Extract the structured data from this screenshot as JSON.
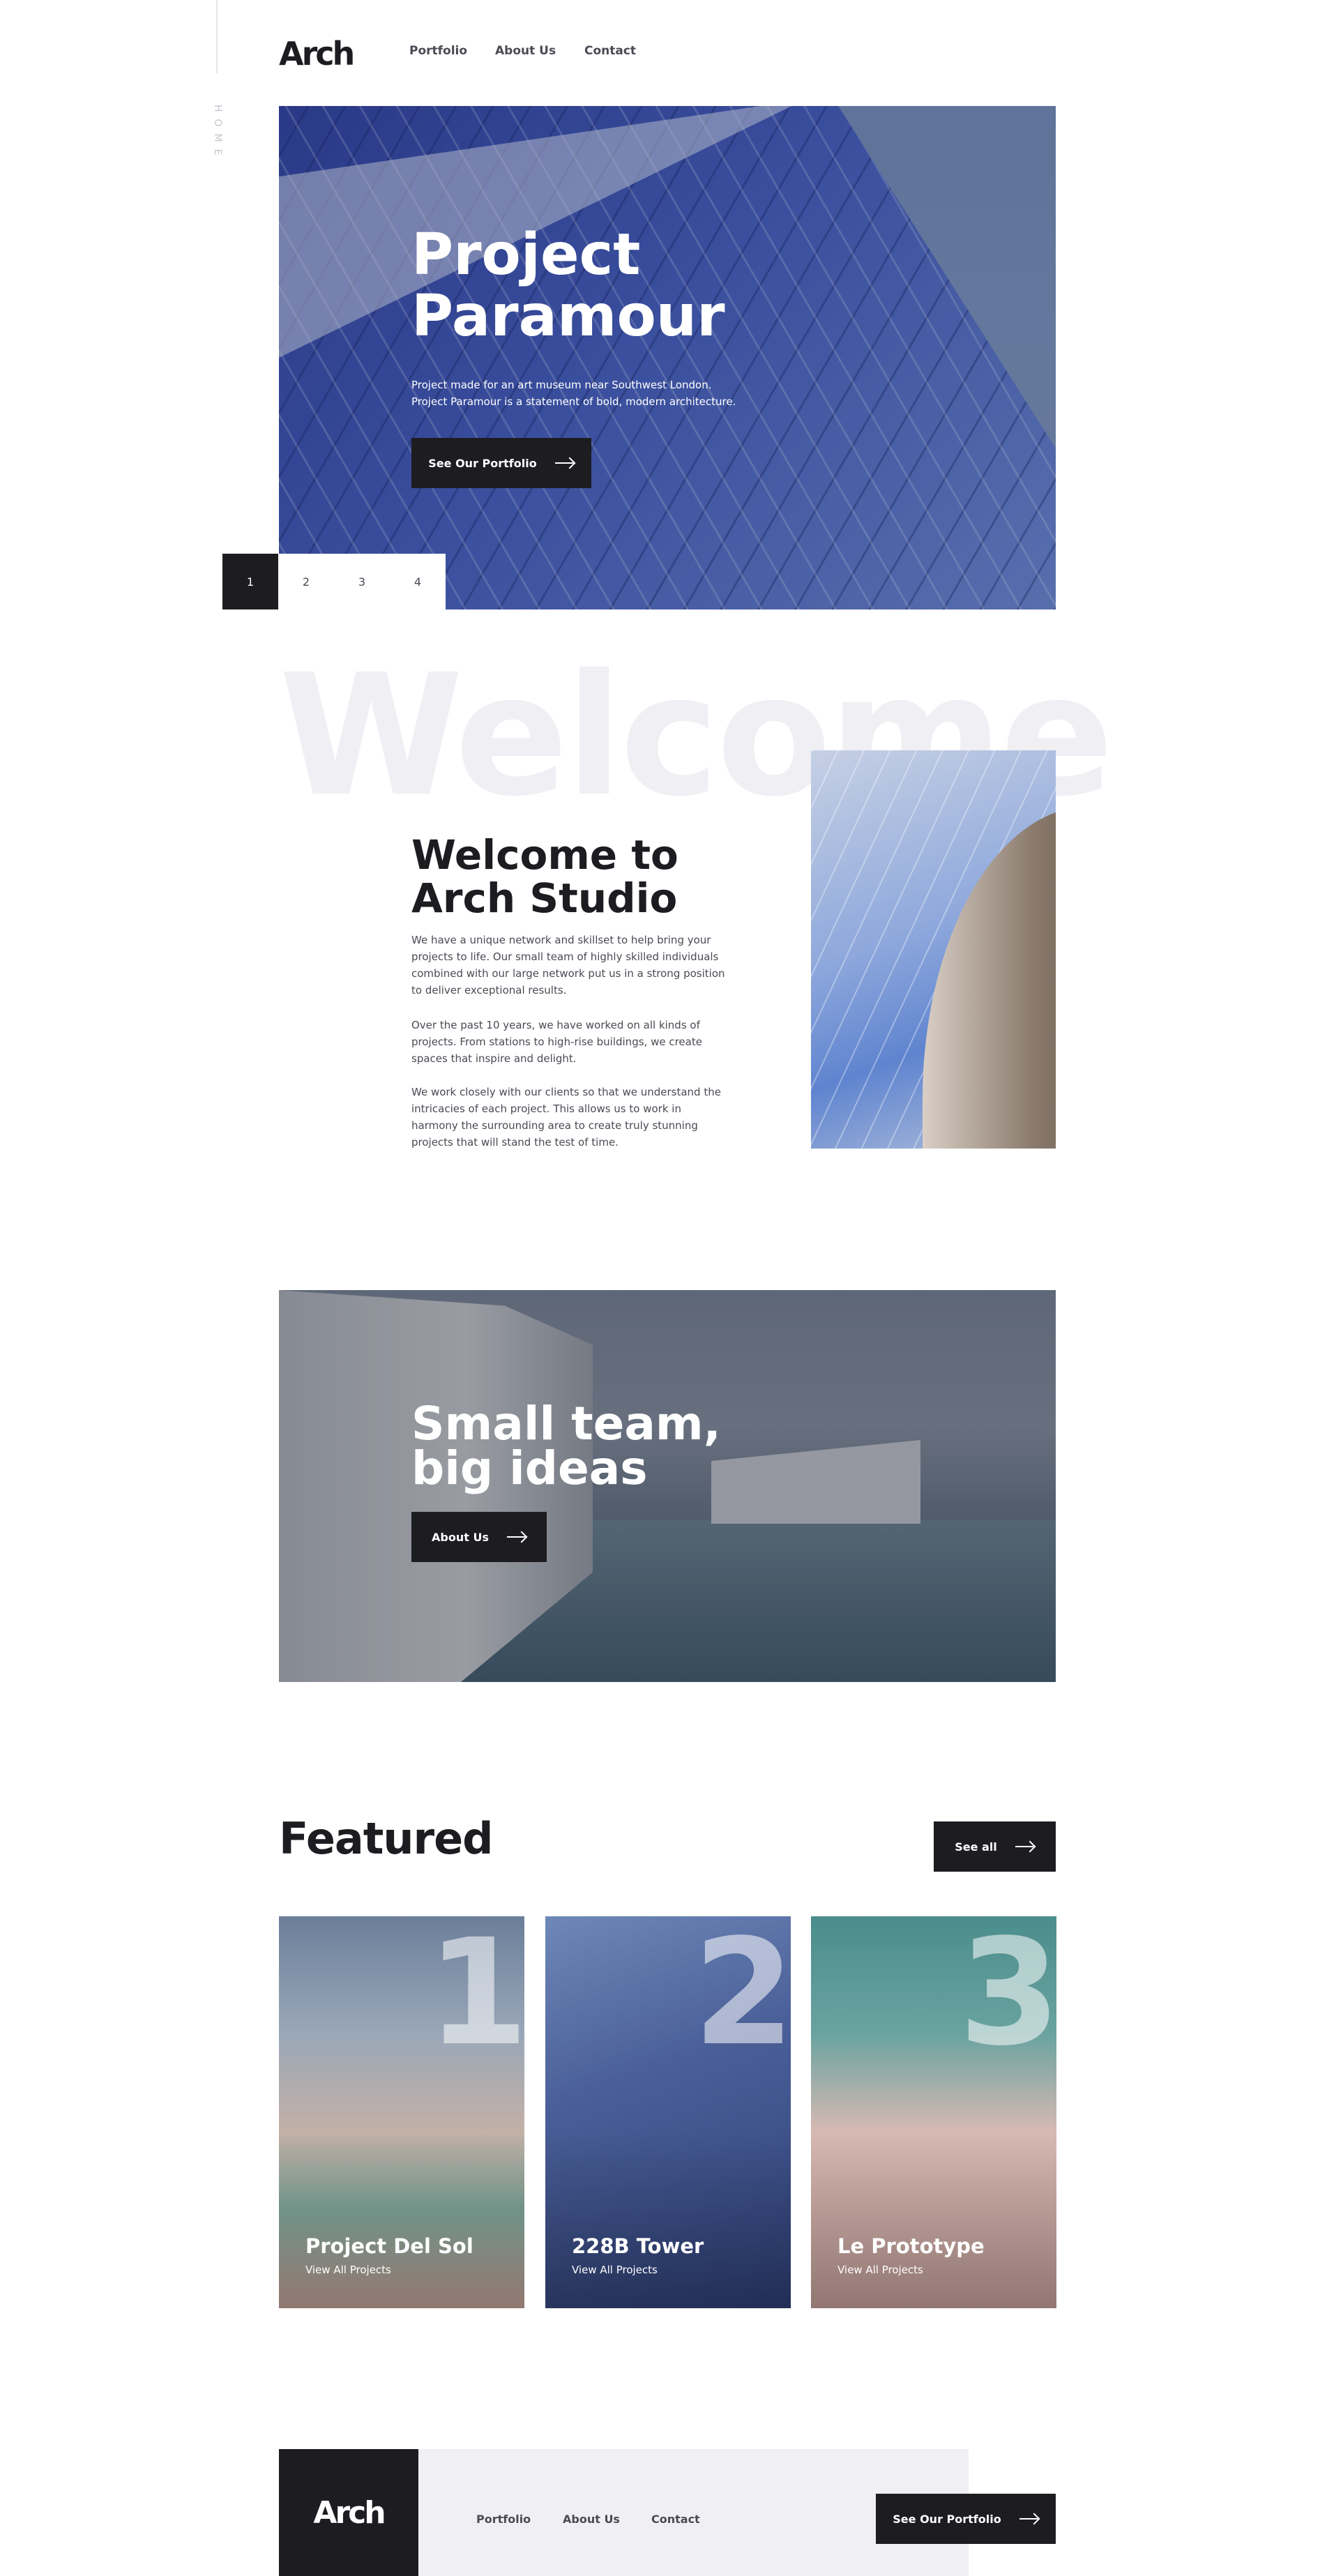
{
  "header": {
    "logo": "Arch",
    "side_label": "HOME",
    "nav": [
      "Portfolio",
      "About Us",
      "Contact"
    ]
  },
  "hero": {
    "title_line1": "Project",
    "title_line2": "Paramour",
    "subtitle_line1": "Project made for an art museum near Southwest London.",
    "subtitle_line2": "Project Paramour is a statement of bold, modern architecture.",
    "button": "See Our Portfolio",
    "pager": [
      "1",
      "2",
      "3",
      "4"
    ],
    "active_slide": "1"
  },
  "welcome": {
    "background_word": "Welcome",
    "title_line1": "Welcome to",
    "title_line2": "Arch Studio",
    "paragraphs": [
      "We have a unique network and skillset to help bring your projects to life. Our small team of highly skilled individuals combined with our large network put us in a strong position to deliver exceptional results.",
      "Over the past 10 years, we have worked on all kinds of projects. From stations to high-rise buildings, we create spaces that inspire and delight.",
      "We work closely with our clients so that we understand the intricacies of each project. This allows us to work in harmony the surrounding area to create truly stunning projects that will stand the test of time."
    ]
  },
  "team": {
    "title_line1": "Small team,",
    "title_line2": "big ideas",
    "button": "About Us"
  },
  "featured": {
    "title": "Featured",
    "see_all": "See all",
    "cards": [
      {
        "num": "1",
        "title": "Project Del Sol",
        "link": "View All Projects"
      },
      {
        "num": "2",
        "title": "228B Tower",
        "link": "View All Projects"
      },
      {
        "num": "3",
        "title": "Le Prototype",
        "link": "View All Projects"
      }
    ]
  },
  "footer": {
    "logo": "Arch",
    "nav": [
      "Portfolio",
      "About Us",
      "Contact"
    ],
    "button": "See Our Portfolio"
  },
  "colors": {
    "dark": "#1D1C21",
    "light_gray": "#EFEFF4",
    "text_gray": "#4B4A54"
  }
}
